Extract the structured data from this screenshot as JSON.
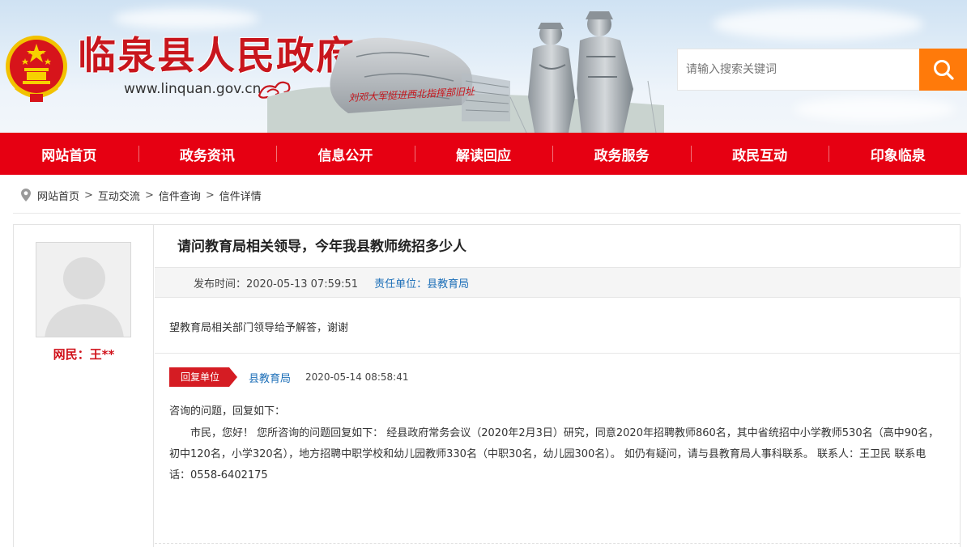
{
  "header": {
    "site_title": "临泉县人民政府",
    "site_url": "www.linquan.gov.cn",
    "scene_caption": "刘邓大军挺进西北指挥部旧址",
    "search_placeholder": "请输入搜索关键词",
    "search_icon": "search-icon"
  },
  "nav": {
    "items": [
      "网站首页",
      "政务资讯",
      "信息公开",
      "解读回应",
      "政务服务",
      "政民互动",
      "印象临泉"
    ]
  },
  "breadcrumb": {
    "icon": "location-pin-icon",
    "items": [
      "网站首页",
      "互动交流",
      "信件查询",
      "信件详情"
    ],
    "separator": ">"
  },
  "letter": {
    "user_name": "网民：王**",
    "title": "请问教育局相关领导，今年我县教师统招多少人",
    "publish_time": "发布时间：2020-05-13 07:59:51",
    "responsible_unit": "责任单位：县教育局",
    "question": "望教育局相关部门领导给予解答，谢谢"
  },
  "reply": {
    "tag": "回复单位",
    "unit": "县教育局",
    "time": "2020-05-14 08:58:41",
    "intro": "咨询的问题，回复如下：",
    "body": "市民，您好！ 您所咨询的问题回复如下： 经县政府常务会议（2020年2月3日）研究，同意2020年招聘教师860名，其中省统招中小学教师530名（高中90名，初中120名，小学320名），地方招聘中职学校和幼儿园教师330名（中职30名，幼儿园300名）。 如仍有疑问，请与县教育局人事科联系。 联系人：王卫民 联系电话：0558-6402175"
  },
  "colors": {
    "brand_red": "#e60012",
    "search_orange": "#ff7a0a",
    "link_blue": "#1d6fb8"
  }
}
